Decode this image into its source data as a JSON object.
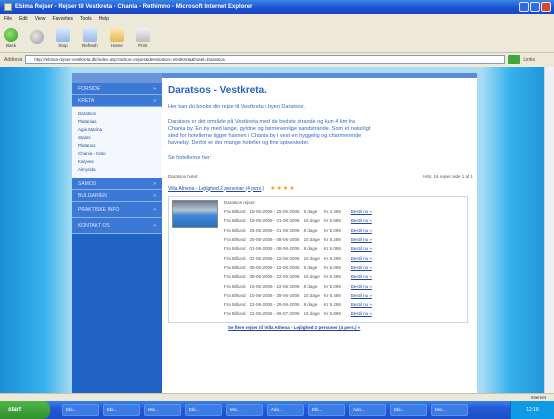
{
  "window": {
    "title": "Ebima Rejser - Rejser til Vestkreta - Chania - Rethimno - Microsoft Internet Explorer"
  },
  "menu": [
    "File",
    "Edit",
    "View",
    "Favorites",
    "Tools",
    "Help"
  ],
  "toolbar": [
    {
      "label": "Back",
      "icon": "back-icon"
    },
    {
      "label": "",
      "icon": "forward-icon"
    },
    {
      "label": "Stop",
      "icon": "stop-icon"
    },
    {
      "label": "Refresh",
      "icon": "refresh-icon"
    },
    {
      "label": "Home",
      "icon": "home-icon"
    },
    {
      "label": "Print",
      "icon": "print-icon"
    }
  ],
  "address": {
    "label": "Address",
    "value": "http://ebima-rejser-vestkreta.dk/index.asp?action=rejser&destination=Vestkreta&hotel=Daratsos",
    "links_label": "Links"
  },
  "sidebar": {
    "sections_top": [
      {
        "label": "FORSIDE"
      },
      {
        "label": "KRETA"
      }
    ],
    "items": [
      "Daratsos",
      "Platanias",
      "Agia Marina",
      "Stalos",
      "Platanos",
      "Chania - Kato",
      "Kalyves",
      "Almyrida"
    ],
    "sections_bottom": [
      {
        "label": "SAMOS"
      },
      {
        "label": "BULGARIEN"
      },
      {
        "label": "PRAKTISKE INFO"
      },
      {
        "label": "KONTAKT OS"
      }
    ]
  },
  "content": {
    "title": "Daratsos - Vestkreta.",
    "intro": "Her kan du booke din rejse til Vestkreta i byen Daratsos.",
    "body": "Daratsos er det område på Vestkreta med de bedste strande og kun 4 km fra Chania by. En by med lange, gyldne og børnevenlige sandstrande. Som et naturligt sted for hotellerne ligger havnen i Chania by i vest en hyggelig og charmerende havneby. Derfor er der mange hoteller og fine spisesteder.",
    "hotels_line": "Se hotellerne her:",
    "results_left": "Daratsos hotel:",
    "results_right": "Hits: 16 rejser side 1 af 1"
  },
  "hotel": {
    "name": "Villa Athena - Lejlighed 2 personer (4 pers.)",
    "stars": "★★★★",
    "box_title": "Daratsos rejser:",
    "offers": [
      [
        "Fra Billund",
        "18-05-2006 - 25-05-2006",
        "8 dage",
        "Kr 4.498",
        "Bestil nu »"
      ],
      [
        "Fra Billund",
        "18-05-2006 - 01-06-2006",
        "15 dage",
        "Kr 5.698",
        "Bestil nu »"
      ],
      [
        "Fra Billund",
        "25-05-2006 - 01-06-2006",
        "8 dage",
        "Kr 5.098",
        "Bestil nu »"
      ],
      [
        "Fra Billund",
        "25-05-2006 - 08-06-2006",
        "15 dage",
        "Kr 6.298",
        "Bestil nu »"
      ],
      [
        "Fra Billund",
        "01-06-2006 - 08-06-2006",
        "8 dage",
        "Kr 5.098",
        "Bestil nu »"
      ],
      [
        "Fra Billund",
        "01-06-2006 - 15-06-2006",
        "15 dage",
        "Kr 6.298",
        "Bestil nu »"
      ],
      [
        "Fra Billund",
        "08-06-2006 - 15-06-2006",
        "8 dage",
        "Kr 5.098",
        "Bestil nu »"
      ],
      [
        "Fra Billund",
        "08-06-2006 - 22-06-2006",
        "15 dage",
        "Kr 6.298",
        "Bestil nu »"
      ],
      [
        "Fra Billund",
        "15-06-2006 - 22-06-2006",
        "8 dage",
        "Kr 5.098",
        "Bestil nu »"
      ],
      [
        "Fra Billund",
        "15-06-2006 - 29-06-2006",
        "15 dage",
        "Kr 6.498",
        "Bestil nu »"
      ],
      [
        "Fra Billund",
        "22-06-2006 - 29-06-2006",
        "8 dage",
        "Kr 5.298",
        "Bestil nu »"
      ],
      [
        "Fra Billund",
        "22-06-2006 - 06-07-2006",
        "15 dage",
        "Kr 6.898",
        "Bestil nu »"
      ]
    ],
    "footer_link": "Se flere rejser til Villa Athena - Lejlighed 2 personer (4 pers.) »"
  },
  "status": {
    "zone": "Internet"
  },
  "taskbar": {
    "start": "start",
    "tasks": [
      "Ebi...",
      "Ebi...",
      "Mic...",
      "Ebi...",
      "Mic...",
      "Ado...",
      "Ebi...",
      "Ado...",
      "Ebi...",
      "Mic..."
    ],
    "clock": "12:18"
  }
}
